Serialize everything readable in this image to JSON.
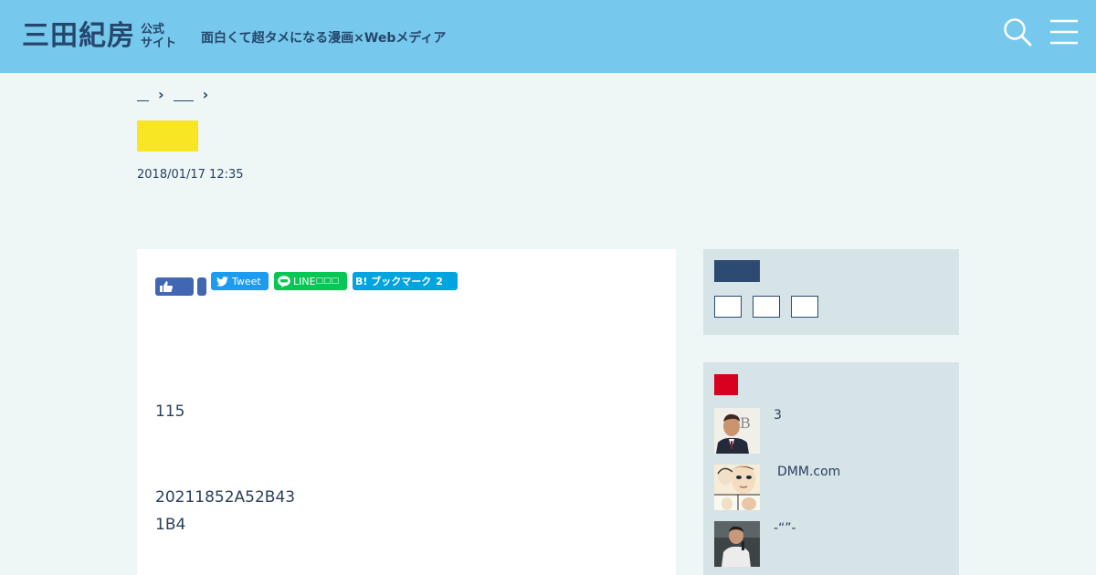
{
  "header": {
    "logo_main": "三田紀房",
    "logo_sub_1": "公式",
    "logo_sub_2": "サイト",
    "tagline": "面白くて超タメになる漫画×Webメディア",
    "search_icon": "search-icon",
    "menu_icon": "hamburger-menu-icon",
    "background_color": "#76c9ec",
    "text_color": "#25466d"
  },
  "breadcrumb": {
    "separator": "›"
  },
  "article": {
    "category_badge_color": "#f8e523",
    "date": "2018/01/17 12:35",
    "share": {
      "tweet_label": "Tweet",
      "line_label": "LINE",
      "line_suffix": "□□□",
      "hatena_label": "B! ブックマーク",
      "hatena_count": "2"
    },
    "paragraphs": [
      "115",
      "20211852A52B43",
      "1B4"
    ]
  },
  "sidebar": {
    "title_bar_color": "#2c4a72",
    "ranking_badge_color": "#d7001e",
    "ranking": [
      {
        "title": "3",
        "thumb_icon": "person-in-suit-photo"
      },
      {
        "title": "DMM.com",
        "thumb_icon": "manga-faces-illustration"
      },
      {
        "title": "-“”-",
        "thumb_icon": "speaker-photo"
      }
    ]
  }
}
